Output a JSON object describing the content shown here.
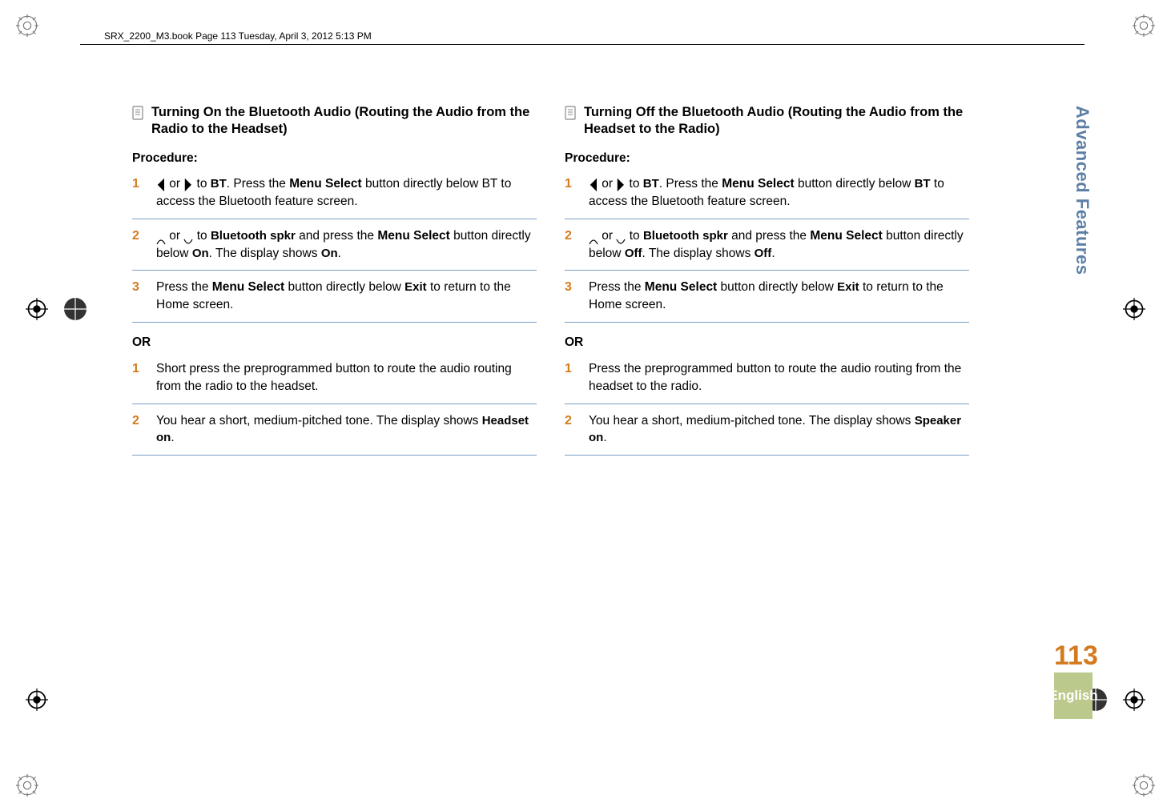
{
  "header": "SRX_2200_M3.book  Page 113  Tuesday, April 3, 2012  5:13 PM",
  "side": {
    "section": "Advanced Features",
    "page": "113",
    "lang": "English"
  },
  "left": {
    "title": "Turning On the Bluetooth Audio (Routing the Audio from the Radio to the Headset)",
    "procLabel": "Procedure:",
    "steps": [
      {
        "pre": "",
        "nav1": "◀",
        "mid1": " or ",
        "nav2": "▶",
        "mid2": " to ",
        "disp1": "BT",
        "mid3": ". Press the ",
        "bold1": "Menu Select",
        "post1": " button directly below BT to access the Bluetooth feature screen."
      },
      {
        "up": "▲",
        "mid1": " or ",
        "down": "▼",
        "mid2": " to ",
        "disp1": "Bluetooth spkr",
        "mid3": " and press the ",
        "bold1": "Menu Select",
        "mid4": " button directly below ",
        "disp2": "On",
        "mid5": ". The display shows ",
        "disp3": "On",
        "post1": "."
      },
      {
        "pre": "Press the ",
        "bold1": "Menu Select",
        "mid1": " button directly below ",
        "disp1": "Exit",
        "post1": " to return to the Home screen."
      }
    ],
    "orLabel": "OR",
    "altSteps": [
      {
        "text": "Short press the preprogrammed button to route the audio routing from the radio to the headset."
      },
      {
        "pre": "You hear a short, medium-pitched tone. The display shows ",
        "disp1": "Headset on",
        "post1": "."
      }
    ]
  },
  "right": {
    "title": "Turning Off the Bluetooth Audio (Routing the Audio from the Headset to the Radio)",
    "procLabel": "Procedure:",
    "steps": [
      {
        "pre": "",
        "nav1": "◀",
        "mid1": " or ",
        "nav2": "▶",
        "mid2": " to ",
        "disp1": "BT",
        "mid3": ". Press the ",
        "bold1": "Menu Select",
        "post1": " button directly below ",
        "disp0": "BT",
        "post2": " to access the Bluetooth feature screen."
      },
      {
        "up": "▲",
        "mid1": " or ",
        "down": "▼",
        "mid2": " to ",
        "disp1": "Bluetooth spkr",
        "mid3": " and press the ",
        "bold1": "Menu Select",
        "mid4": " button directly below ",
        "disp2": "Off",
        "mid5": ". The display shows ",
        "disp3": "Off",
        "post1": "."
      },
      {
        "pre": "Press the ",
        "bold1": "Menu Select",
        "mid1": " button directly below ",
        "disp1": "Exit",
        "post1": " to return to the Home screen."
      }
    ],
    "orLabel": "OR",
    "altSteps": [
      {
        "text": "Press the preprogrammed button to route the audio routing from the headset to the radio."
      },
      {
        "pre": "You hear a short, medium-pitched tone. The display shows ",
        "disp1": "Speaker on",
        "post1": "."
      }
    ]
  }
}
